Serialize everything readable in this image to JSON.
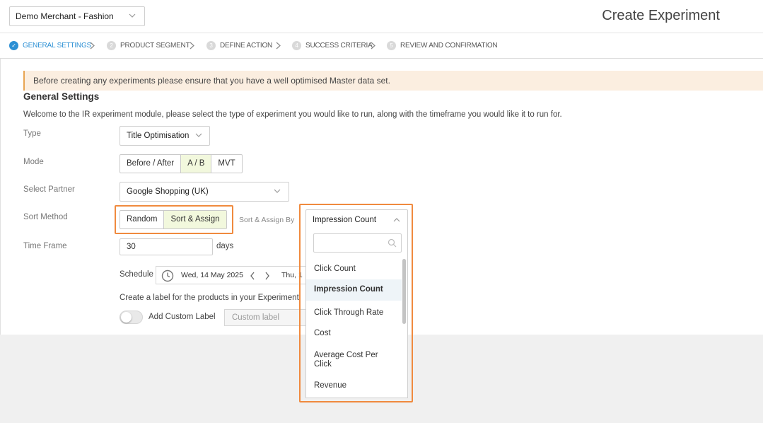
{
  "header": {
    "merchant_select": "Demo Merchant - Fashion",
    "page_title": "Create Experiment"
  },
  "steps": [
    {
      "num": "✓",
      "label": "GENERAL SETTINGS",
      "active": true
    },
    {
      "num": "2",
      "label": "PRODUCT SEGMENT",
      "active": false
    },
    {
      "num": "3",
      "label": "DEFINE ACTION",
      "active": false
    },
    {
      "num": "4",
      "label": "SUCCESS CRITERIA",
      "active": false
    },
    {
      "num": "5",
      "label": "REVIEW AND CONFIRMATION",
      "active": false
    }
  ],
  "notice": "Before creating any experiments please ensure that you have a well optimised Master data set.",
  "section": {
    "title": "General Settings",
    "intro": "Welcome to the IR experiment module, please select the type of experiment you would like to run, along with the timeframe you would like it to run for."
  },
  "form": {
    "type": {
      "label": "Type",
      "value": "Title Optimisation"
    },
    "mode": {
      "label": "Mode",
      "options": [
        "Before / After",
        "A / B",
        "MVT"
      ],
      "selected": "A / B"
    },
    "partner": {
      "label": "Select Partner",
      "value": "Google Shopping (UK)"
    },
    "sort_method": {
      "label": "Sort Method",
      "options": [
        "Random",
        "Sort & Assign"
      ],
      "selected": "Sort & Assign"
    },
    "sort_assign_by": {
      "label": "Sort & Assign By",
      "value": "Impression Count",
      "search_placeholder": "",
      "options": [
        "Click Count",
        "Impression Count",
        "Click Through Rate",
        "Cost",
        "Average Cost Per Click",
        "Revenue"
      ],
      "selected": "Impression Count"
    },
    "time_frame": {
      "label": "Time Frame",
      "value": "30",
      "unit": "days"
    },
    "schedule": {
      "label": "Schedule",
      "start_date": "Wed, 14 May 2025",
      "end_date_partial": "Thu, 1"
    },
    "custom_label": {
      "intro": "Create a label for the products in your Experiment.",
      "toggle_label": "Add Custom Label",
      "placeholder": "Custom label"
    }
  },
  "colors": {
    "accent": "#2b8fd4",
    "highlight_border": "#f08a3e",
    "notice_bg": "#fbeee0",
    "selected_segment_bg": "#f2f8dd"
  }
}
